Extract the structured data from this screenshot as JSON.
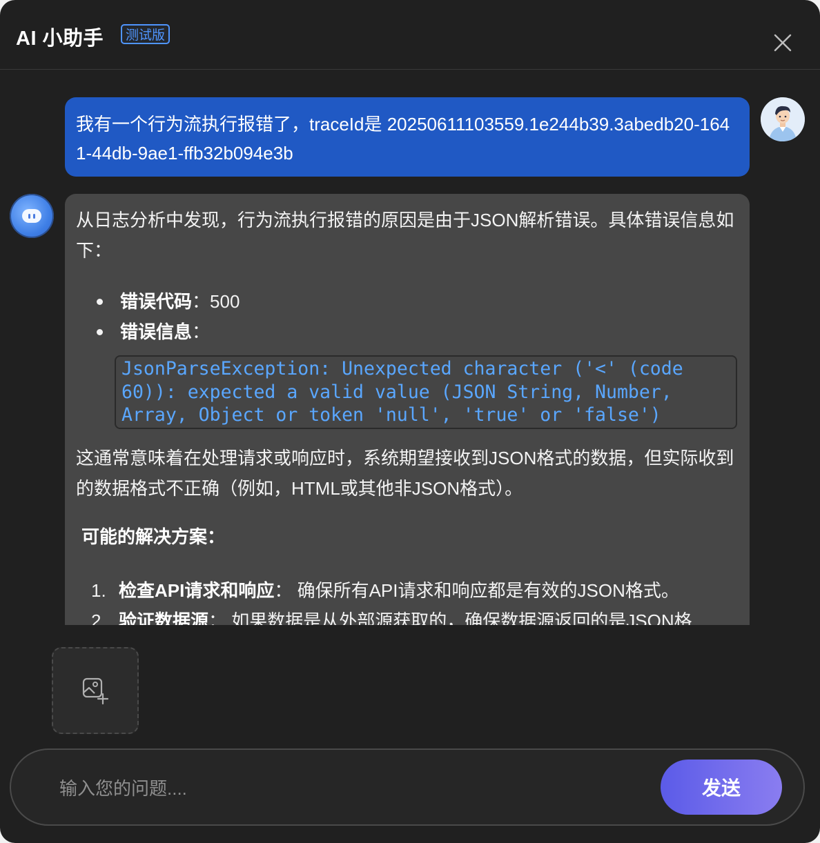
{
  "header": {
    "title": "AI 小助手",
    "badge": "测试版",
    "close_icon": "close-icon"
  },
  "user_message": {
    "text": "我有一个行为流执行报错了，traceId是 20250611103559.1e244b39.3abedb20-1641-44db-9ae1-ffb32b094e3b",
    "avatar_icon": "user-avatar"
  },
  "bot_message": {
    "avatar_icon": "bot-avatar",
    "intro": "从日志分析中发现，行为流执行报错的原因是由于JSON解析错误。具体错误信息如下：",
    "bullets": [
      {
        "label": "错误代码",
        "sep": "：",
        "value": "500"
      },
      {
        "label": "错误信息",
        "sep": "：",
        "value": ""
      }
    ],
    "code": "JsonParseException: Unexpected character ('<' (code 60)): expected a valid value (JSON String, Number, Array, Object or token 'null', 'true' or 'false')",
    "explanation": "这通常意味着在处理请求或响应时，系统期望接收到JSON格式的数据，但实际收到的数据格式不正确（例如，HTML或其他非JSON格式）。",
    "solutions_heading": "可能的解决方案：",
    "solutions": [
      {
        "num": "1.",
        "title": "检查API请求和响应",
        "sep": "：",
        "text": "确保所有API请求和响应都是有效的JSON格式。"
      },
      {
        "num": "2.",
        "title": "验证数据源",
        "sep": "：",
        "text": "如果数据是从外部源获取的，确保数据源返回的是JSON格"
      }
    ]
  },
  "attachment": {
    "icon": "add-image-icon"
  },
  "input": {
    "placeholder": "输入您的问题....",
    "value": ""
  },
  "send_button": {
    "label": "发送"
  },
  "colors": {
    "background": "#202020",
    "user_bubble": "#2059c4",
    "bot_bubble": "#474747",
    "badge": "#4f95ff",
    "code_text": "#5aa7ff",
    "send_gradient_start": "#5b5be8",
    "send_gradient_end": "#8a7df0"
  }
}
